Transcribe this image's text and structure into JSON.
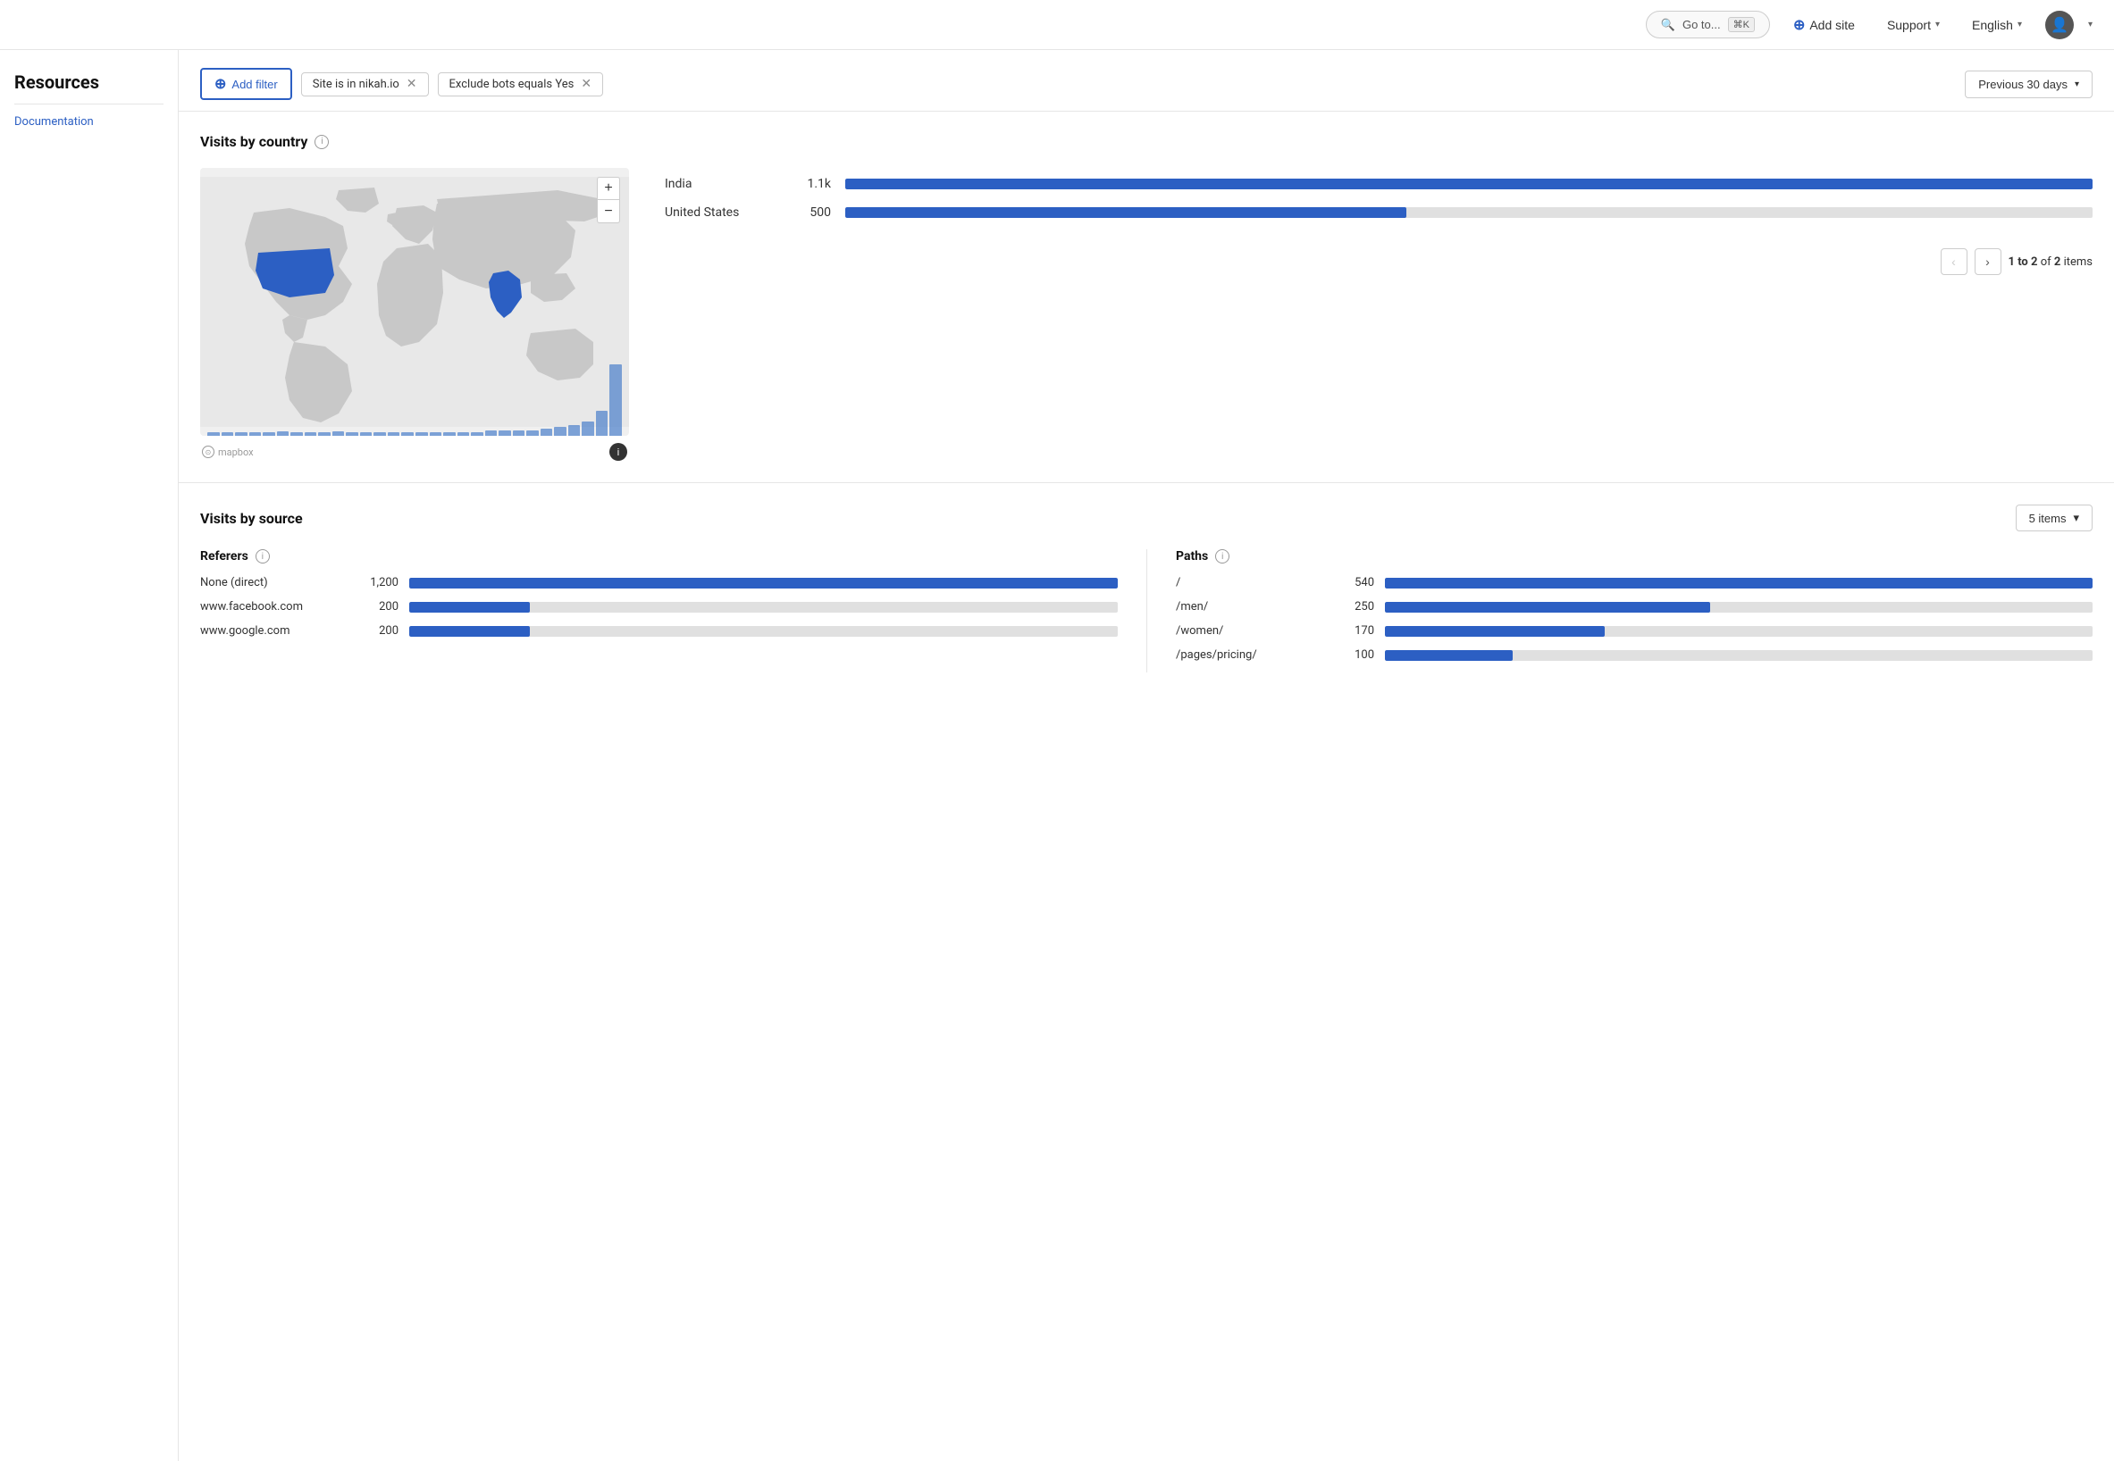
{
  "topnav": {
    "goto_label": "Go to...",
    "goto_kbd": "⌘K",
    "add_site_label": "Add site",
    "support_label": "Support",
    "language_label": "English"
  },
  "sidebar": {
    "title": "Resources",
    "links": [
      {
        "label": "Documentation",
        "href": "#"
      }
    ]
  },
  "toolbar": {
    "add_filter_label": "Add filter",
    "filters": [
      {
        "label": "Site is in nikah.io",
        "id": "filter-site"
      },
      {
        "label": "Exclude bots equals Yes",
        "id": "filter-bots"
      }
    ],
    "date_range_label": "Previous 30 days"
  },
  "visits_by_country": {
    "title": "Visits by country",
    "countries": [
      {
        "name": "India",
        "value": "1.1k",
        "bar_pct": 100
      },
      {
        "name": "United States",
        "value": "500",
        "bar_pct": 45
      }
    ],
    "pagination": {
      "current": "1 to 2",
      "total": "2",
      "unit": "items"
    },
    "map_controls": {
      "zoom_in": "+",
      "zoom_out": "−"
    }
  },
  "visits_by_source": {
    "title": "Visits by source",
    "items_label": "5 items",
    "referers": {
      "title": "Referers",
      "items": [
        {
          "label": "None (direct)",
          "value": "1,200",
          "bar_pct": 100
        },
        {
          "label": "www.facebook.com",
          "value": "200",
          "bar_pct": 17
        },
        {
          "label": "www.google.com",
          "value": "200",
          "bar_pct": 17
        }
      ]
    },
    "paths": {
      "title": "Paths",
      "items": [
        {
          "label": "/",
          "value": "540",
          "bar_pct": 100
        },
        {
          "label": "/men/",
          "value": "250",
          "bar_pct": 46
        },
        {
          "label": "/women/",
          "value": "170",
          "bar_pct": 31
        },
        {
          "label": "/pages/pricing/",
          "value": "100",
          "bar_pct": 18
        }
      ]
    }
  },
  "colors": {
    "accent": "#2c5fc3",
    "bar_bg": "#d0d8ec",
    "map_country_highlight": "#2c5fc3",
    "map_country_default": "#c8c8c8"
  }
}
